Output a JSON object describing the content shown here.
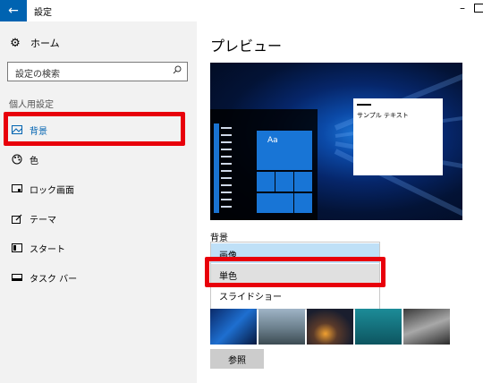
{
  "window": {
    "title": "設定",
    "back_icon": "back-arrow-icon"
  },
  "sidebar": {
    "home_label": "ホーム",
    "search_placeholder": "設定の検索",
    "section_label": "個人用設定",
    "items": [
      {
        "label": "背景",
        "icon": "picture-icon",
        "active": true
      },
      {
        "label": "色",
        "icon": "palette-icon",
        "active": false
      },
      {
        "label": "ロック画面",
        "icon": "lock-screen-icon",
        "active": false
      },
      {
        "label": "テーマ",
        "icon": "theme-brush-icon",
        "active": false
      },
      {
        "label": "スタート",
        "icon": "start-icon",
        "active": false
      },
      {
        "label": "タスク バー",
        "icon": "taskbar-icon",
        "active": false
      }
    ]
  },
  "main": {
    "preview_title": "プレビュー",
    "preview": {
      "tile_label": "Aa",
      "sample_text": "サンプル テキスト"
    },
    "background_label": "背景",
    "dropdown_options": [
      "画像",
      "単色",
      "スライドショー"
    ],
    "browse_label": "参照"
  },
  "colors": {
    "accent": "#0063b1",
    "highlight_red": "#e8000b",
    "sidebar_bg": "#f2f2f2"
  }
}
